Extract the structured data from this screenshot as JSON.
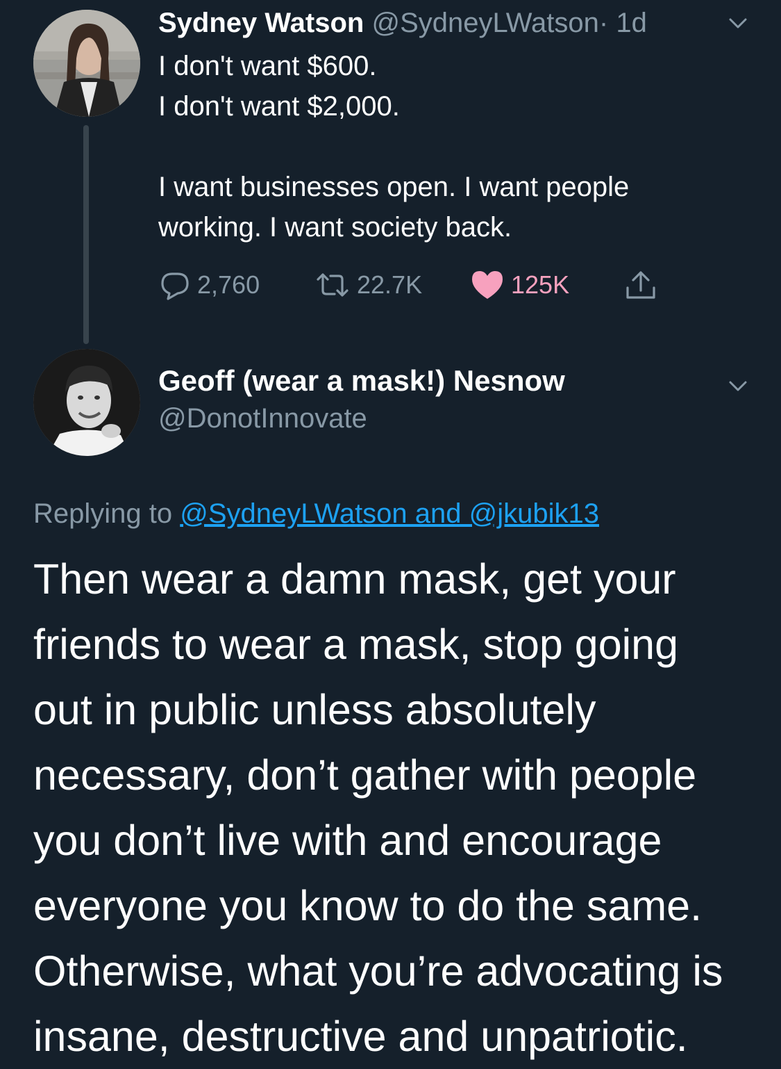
{
  "tweet": {
    "author_name": "Sydney Watson",
    "author_handle": "@SydneyLWatson",
    "separator": "·",
    "time": "1d",
    "lines": [
      "I don't want $600.",
      "I don't want $2,000."
    ],
    "lines2": [
      "I want businesses open. I want people",
      "working. I want society back."
    ],
    "reply_count": "2,760",
    "retweet_count": "22.7K",
    "like_count": "125K"
  },
  "reply": {
    "author_name": "Geoff (wear a mask!) Nesnow",
    "author_handle": "@DonotInnovate",
    "replying_prefix": "Replying to",
    "replying_to": "@SydneyLWatson and @jkubik13",
    "lines": [
      "Then wear a damn mask, get your",
      "friends to wear a mask, stop going",
      "out in public unless absolutely",
      "necessary, don’t gather with people",
      "you don’t live with and encourage",
      "everyone you know to do the same.",
      "Otherwise, what you’re advocating is",
      "insane, destructive and unpatriotic."
    ]
  },
  "colors": {
    "background": "#15202b",
    "muted": "#8899a6",
    "link": "#1da1f2",
    "like": "#e0245e",
    "thread_line": "#38444d"
  },
  "icons": [
    "reply-icon",
    "retweet-icon",
    "like-heart-icon",
    "share-icon",
    "chevron-down-icon"
  ]
}
